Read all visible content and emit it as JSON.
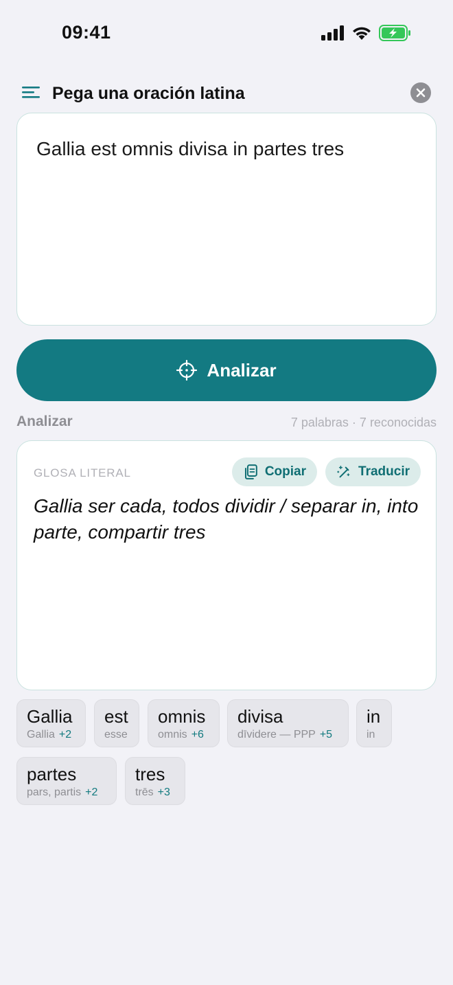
{
  "status": {
    "time": "09:41"
  },
  "header": {
    "title": "Pega una oración latina"
  },
  "input": {
    "value": "Gallia est omnis divisa in partes tres"
  },
  "analyze_button": {
    "label": "Analizar"
  },
  "section": {
    "title": "Analizar",
    "meta": "7 palabras · 7 reconocidas"
  },
  "gloss": {
    "label": "GLOSA LITERAL",
    "copy_label": "Copiar",
    "translate_label": "Traducir",
    "text": "Gallia ser cada, todos dividir / separar in, into parte, compartir tres"
  },
  "tokens": [
    {
      "word": "Gallia",
      "lemma": "Gallia",
      "more": "+2"
    },
    {
      "word": "est",
      "lemma": "esse",
      "more": ""
    },
    {
      "word": "omnis",
      "lemma": "omnis",
      "more": "+6"
    },
    {
      "word": "divisa",
      "lemma": "dīvidere — PPP",
      "more": "+5"
    },
    {
      "word": "in",
      "lemma": "in",
      "more": ""
    },
    {
      "word": "partes",
      "lemma": "pars, partis",
      "more": "+2"
    },
    {
      "word": "tres",
      "lemma": "trēs",
      "more": "+3"
    }
  ],
  "colors": {
    "accent": "#137a82",
    "chip_bg": "#dcecea",
    "battery": "#34c759"
  },
  "icons": [
    "menu-icon",
    "close-icon",
    "crosshair-icon",
    "copy-icon",
    "magic-wand-icon",
    "signal-icon",
    "wifi-icon",
    "battery-icon"
  ]
}
